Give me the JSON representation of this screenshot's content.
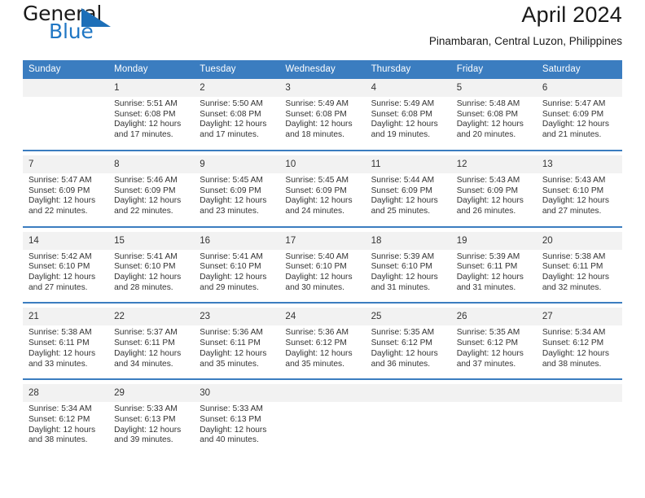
{
  "logo": {
    "word_one": "General",
    "word_two": "Blue",
    "triangle_color": "#1d6fb8",
    "blue_color": "#2077c4"
  },
  "header": {
    "title": "April 2024",
    "subtitle": "Pinambaran, Central Luzon, Philippines"
  },
  "theme": {
    "header_blue": "#3b7dc0",
    "daynum_gray": "#f2f2f2"
  },
  "weekdays": [
    "Sunday",
    "Monday",
    "Tuesday",
    "Wednesday",
    "Thursday",
    "Friday",
    "Saturday"
  ],
  "weeks": [
    [
      {
        "day": "",
        "sunrise": "",
        "sunset": "",
        "daylight_1": "",
        "daylight_2": ""
      },
      {
        "day": "1",
        "sunrise": "Sunrise: 5:51 AM",
        "sunset": "Sunset: 6:08 PM",
        "daylight_1": "Daylight: 12 hours",
        "daylight_2": "and 17 minutes."
      },
      {
        "day": "2",
        "sunrise": "Sunrise: 5:50 AM",
        "sunset": "Sunset: 6:08 PM",
        "daylight_1": "Daylight: 12 hours",
        "daylight_2": "and 17 minutes."
      },
      {
        "day": "3",
        "sunrise": "Sunrise: 5:49 AM",
        "sunset": "Sunset: 6:08 PM",
        "daylight_1": "Daylight: 12 hours",
        "daylight_2": "and 18 minutes."
      },
      {
        "day": "4",
        "sunrise": "Sunrise: 5:49 AM",
        "sunset": "Sunset: 6:08 PM",
        "daylight_1": "Daylight: 12 hours",
        "daylight_2": "and 19 minutes."
      },
      {
        "day": "5",
        "sunrise": "Sunrise: 5:48 AM",
        "sunset": "Sunset: 6:08 PM",
        "daylight_1": "Daylight: 12 hours",
        "daylight_2": "and 20 minutes."
      },
      {
        "day": "6",
        "sunrise": "Sunrise: 5:47 AM",
        "sunset": "Sunset: 6:09 PM",
        "daylight_1": "Daylight: 12 hours",
        "daylight_2": "and 21 minutes."
      }
    ],
    [
      {
        "day": "7",
        "sunrise": "Sunrise: 5:47 AM",
        "sunset": "Sunset: 6:09 PM",
        "daylight_1": "Daylight: 12 hours",
        "daylight_2": "and 22 minutes."
      },
      {
        "day": "8",
        "sunrise": "Sunrise: 5:46 AM",
        "sunset": "Sunset: 6:09 PM",
        "daylight_1": "Daylight: 12 hours",
        "daylight_2": "and 22 minutes."
      },
      {
        "day": "9",
        "sunrise": "Sunrise: 5:45 AM",
        "sunset": "Sunset: 6:09 PM",
        "daylight_1": "Daylight: 12 hours",
        "daylight_2": "and 23 minutes."
      },
      {
        "day": "10",
        "sunrise": "Sunrise: 5:45 AM",
        "sunset": "Sunset: 6:09 PM",
        "daylight_1": "Daylight: 12 hours",
        "daylight_2": "and 24 minutes."
      },
      {
        "day": "11",
        "sunrise": "Sunrise: 5:44 AM",
        "sunset": "Sunset: 6:09 PM",
        "daylight_1": "Daylight: 12 hours",
        "daylight_2": "and 25 minutes."
      },
      {
        "day": "12",
        "sunrise": "Sunrise: 5:43 AM",
        "sunset": "Sunset: 6:09 PM",
        "daylight_1": "Daylight: 12 hours",
        "daylight_2": "and 26 minutes."
      },
      {
        "day": "13",
        "sunrise": "Sunrise: 5:43 AM",
        "sunset": "Sunset: 6:10 PM",
        "daylight_1": "Daylight: 12 hours",
        "daylight_2": "and 27 minutes."
      }
    ],
    [
      {
        "day": "14",
        "sunrise": "Sunrise: 5:42 AM",
        "sunset": "Sunset: 6:10 PM",
        "daylight_1": "Daylight: 12 hours",
        "daylight_2": "and 27 minutes."
      },
      {
        "day": "15",
        "sunrise": "Sunrise: 5:41 AM",
        "sunset": "Sunset: 6:10 PM",
        "daylight_1": "Daylight: 12 hours",
        "daylight_2": "and 28 minutes."
      },
      {
        "day": "16",
        "sunrise": "Sunrise: 5:41 AM",
        "sunset": "Sunset: 6:10 PM",
        "daylight_1": "Daylight: 12 hours",
        "daylight_2": "and 29 minutes."
      },
      {
        "day": "17",
        "sunrise": "Sunrise: 5:40 AM",
        "sunset": "Sunset: 6:10 PM",
        "daylight_1": "Daylight: 12 hours",
        "daylight_2": "and 30 minutes."
      },
      {
        "day": "18",
        "sunrise": "Sunrise: 5:39 AM",
        "sunset": "Sunset: 6:10 PM",
        "daylight_1": "Daylight: 12 hours",
        "daylight_2": "and 31 minutes."
      },
      {
        "day": "19",
        "sunrise": "Sunrise: 5:39 AM",
        "sunset": "Sunset: 6:11 PM",
        "daylight_1": "Daylight: 12 hours",
        "daylight_2": "and 31 minutes."
      },
      {
        "day": "20",
        "sunrise": "Sunrise: 5:38 AM",
        "sunset": "Sunset: 6:11 PM",
        "daylight_1": "Daylight: 12 hours",
        "daylight_2": "and 32 minutes."
      }
    ],
    [
      {
        "day": "21",
        "sunrise": "Sunrise: 5:38 AM",
        "sunset": "Sunset: 6:11 PM",
        "daylight_1": "Daylight: 12 hours",
        "daylight_2": "and 33 minutes."
      },
      {
        "day": "22",
        "sunrise": "Sunrise: 5:37 AM",
        "sunset": "Sunset: 6:11 PM",
        "daylight_1": "Daylight: 12 hours",
        "daylight_2": "and 34 minutes."
      },
      {
        "day": "23",
        "sunrise": "Sunrise: 5:36 AM",
        "sunset": "Sunset: 6:11 PM",
        "daylight_1": "Daylight: 12 hours",
        "daylight_2": "and 35 minutes."
      },
      {
        "day": "24",
        "sunrise": "Sunrise: 5:36 AM",
        "sunset": "Sunset: 6:12 PM",
        "daylight_1": "Daylight: 12 hours",
        "daylight_2": "and 35 minutes."
      },
      {
        "day": "25",
        "sunrise": "Sunrise: 5:35 AM",
        "sunset": "Sunset: 6:12 PM",
        "daylight_1": "Daylight: 12 hours",
        "daylight_2": "and 36 minutes."
      },
      {
        "day": "26",
        "sunrise": "Sunrise: 5:35 AM",
        "sunset": "Sunset: 6:12 PM",
        "daylight_1": "Daylight: 12 hours",
        "daylight_2": "and 37 minutes."
      },
      {
        "day": "27",
        "sunrise": "Sunrise: 5:34 AM",
        "sunset": "Sunset: 6:12 PM",
        "daylight_1": "Daylight: 12 hours",
        "daylight_2": "and 38 minutes."
      }
    ],
    [
      {
        "day": "28",
        "sunrise": "Sunrise: 5:34 AM",
        "sunset": "Sunset: 6:12 PM",
        "daylight_1": "Daylight: 12 hours",
        "daylight_2": "and 38 minutes."
      },
      {
        "day": "29",
        "sunrise": "Sunrise: 5:33 AM",
        "sunset": "Sunset: 6:13 PM",
        "daylight_1": "Daylight: 12 hours",
        "daylight_2": "and 39 minutes."
      },
      {
        "day": "30",
        "sunrise": "Sunrise: 5:33 AM",
        "sunset": "Sunset: 6:13 PM",
        "daylight_1": "Daylight: 12 hours",
        "daylight_2": "and 40 minutes."
      },
      {
        "day": "",
        "sunrise": "",
        "sunset": "",
        "daylight_1": "",
        "daylight_2": ""
      },
      {
        "day": "",
        "sunrise": "",
        "sunset": "",
        "daylight_1": "",
        "daylight_2": ""
      },
      {
        "day": "",
        "sunrise": "",
        "sunset": "",
        "daylight_1": "",
        "daylight_2": ""
      },
      {
        "day": "",
        "sunrise": "",
        "sunset": "",
        "daylight_1": "",
        "daylight_2": ""
      }
    ]
  ]
}
